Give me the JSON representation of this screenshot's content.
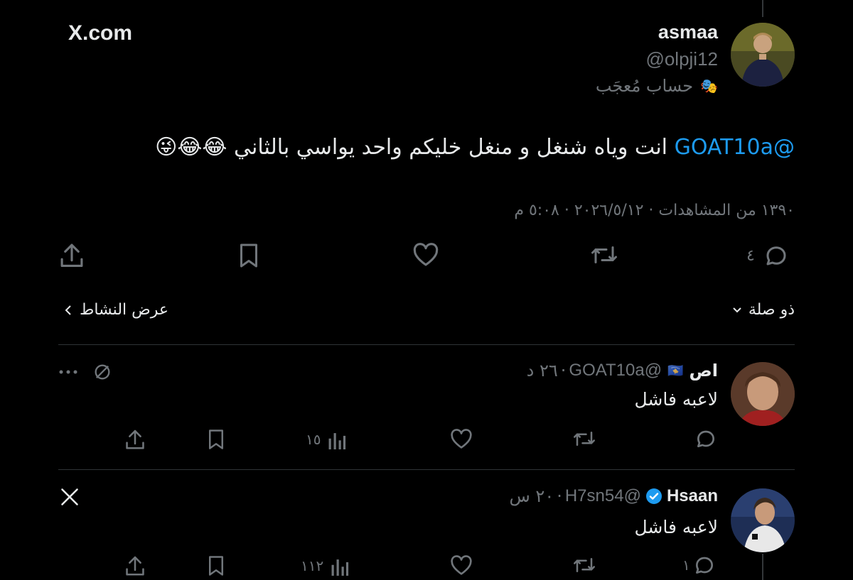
{
  "brand": {
    "label": "X.com"
  },
  "post": {
    "author_name": "asmaa",
    "author_handle": "@olpji12",
    "account_label": "حساب مُعجَب",
    "mention": "@GOAT10a",
    "text": "انت وياه شنغل و منغل خليكم واحد يواسي بالثاني",
    "emojis": "😂😂😜",
    "meta": "١٣٩٠ من المشاهدات · ٢٠٢٦/٥/١٢ · ٥:٠٨ م",
    "reply_count": "٤"
  },
  "filters": {
    "relevance_label": "ذو صلة",
    "activity_label": "عرض النشاط"
  },
  "replies": [
    {
      "name": "اص",
      "flag": "🇽🇰",
      "handle": "@GOAT10a",
      "time": "٢٦ د",
      "text": "لاعبه فاشل",
      "views": "١٥",
      "reply_count": ""
    },
    {
      "name": "Hsaan",
      "handle": "@H7sn54",
      "time": "٢٠ س",
      "text": "لاعبه فاشل",
      "views": "١١٢",
      "reply_count": "١"
    }
  ],
  "colors": {
    "background": "#000000",
    "text": "#e7e9ea",
    "muted": "#71767b",
    "accent": "#1d9bf0",
    "divider": "#2f3336"
  }
}
